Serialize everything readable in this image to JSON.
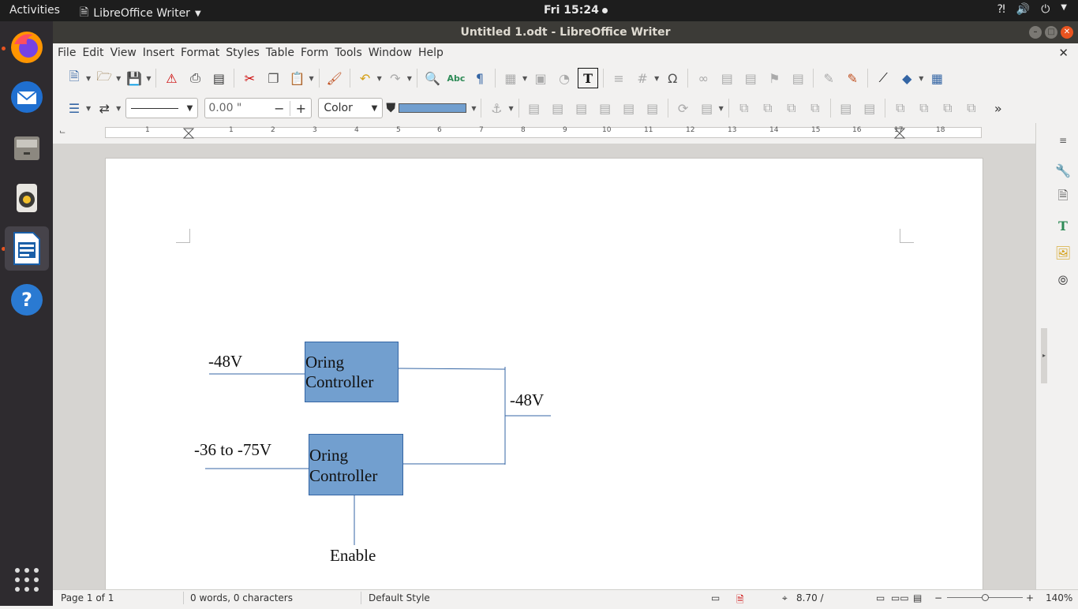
{
  "topbar": {
    "activities": "Activities",
    "app_name": "LibreOffice Writer",
    "clock": "Fri 15:24"
  },
  "window": {
    "title": "Untitled 1.odt - LibreOffice Writer"
  },
  "menu": [
    "File",
    "Edit",
    "View",
    "Insert",
    "Format",
    "Styles",
    "Table",
    "Form",
    "Tools",
    "Window",
    "Help"
  ],
  "toolbar2": {
    "line_width_value": "0.00 \"",
    "area_style": "Color",
    "fill_color": "#729fcf"
  },
  "ruler": {
    "marks": [
      "1",
      "1",
      "2",
      "3",
      "4",
      "5",
      "6",
      "7",
      "8",
      "9",
      "10",
      "11",
      "12",
      "13",
      "14",
      "15",
      "16",
      "17",
      "18"
    ]
  },
  "diagram": {
    "box_fill": "#729fcf",
    "box_top_label": "Oring Controller",
    "box_bottom_label": "Oring Controller",
    "input_top": "-48V",
    "input_bottom": "-36 to -75V",
    "output": "-48V",
    "enable": "Enable"
  },
  "status": {
    "page": "Page 1 of 1",
    "words": "0 words, 0 characters",
    "style": "Default Style",
    "position": "8.70 /",
    "zoom": "140%"
  }
}
